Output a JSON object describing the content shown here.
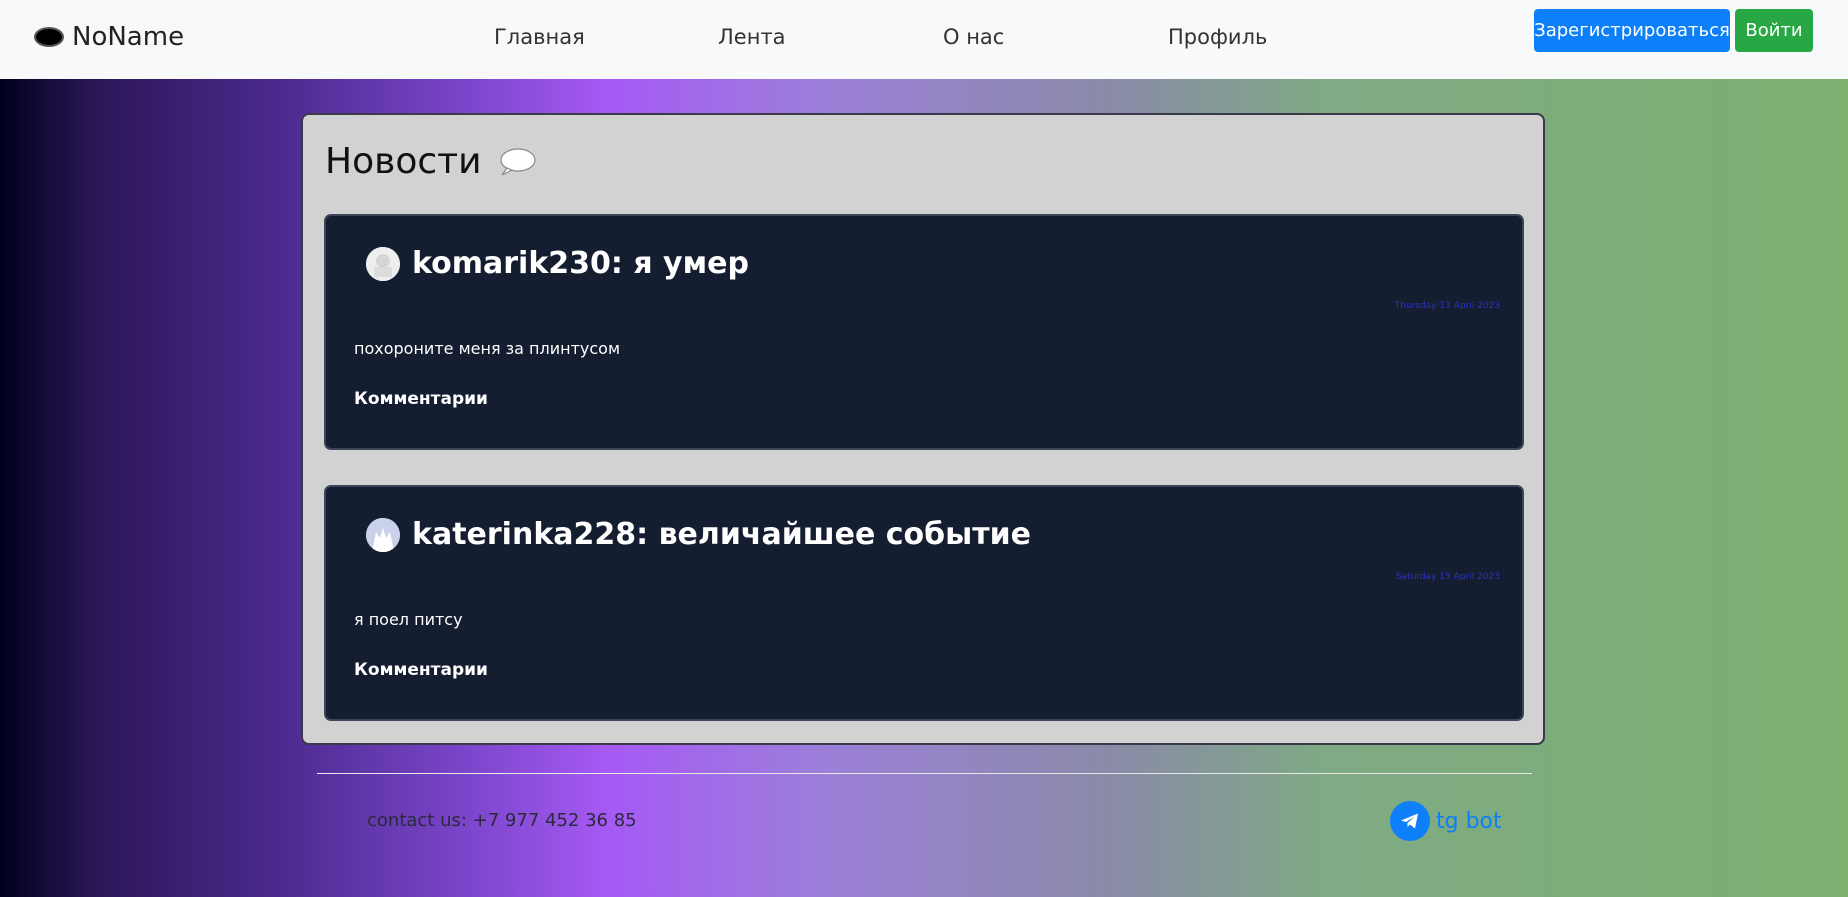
{
  "navbar": {
    "brand": "NoName",
    "links": [
      "Главная",
      "Лента",
      "О нас",
      "Профиль"
    ],
    "register_label": "Зарегистрироваться",
    "login_label": "Войти"
  },
  "news": {
    "title": "Новости",
    "posts": [
      {
        "title": "komarik230: я умер",
        "date": "Thursday 13 April 2023",
        "body": "похороните меня за плинтусом",
        "comments_label": "Комментарии"
      },
      {
        "title": "katerinka228: величайшее событие",
        "date": "Saturday 15 April 2023",
        "body": "я поел питсу",
        "comments_label": "Комментарии"
      }
    ]
  },
  "footer": {
    "contact": "contact us: +7 977 452 36 85",
    "tg_label": "tg bot"
  },
  "colors": {
    "primary": "#0d7ff8",
    "success": "#28a745",
    "post_bg": "#141e30",
    "card_bg": "#d2d2d2"
  },
  "icons": {
    "brand": "oval-logo-icon",
    "news": "speech-bubble-icon",
    "telegram": "telegram-icon"
  }
}
